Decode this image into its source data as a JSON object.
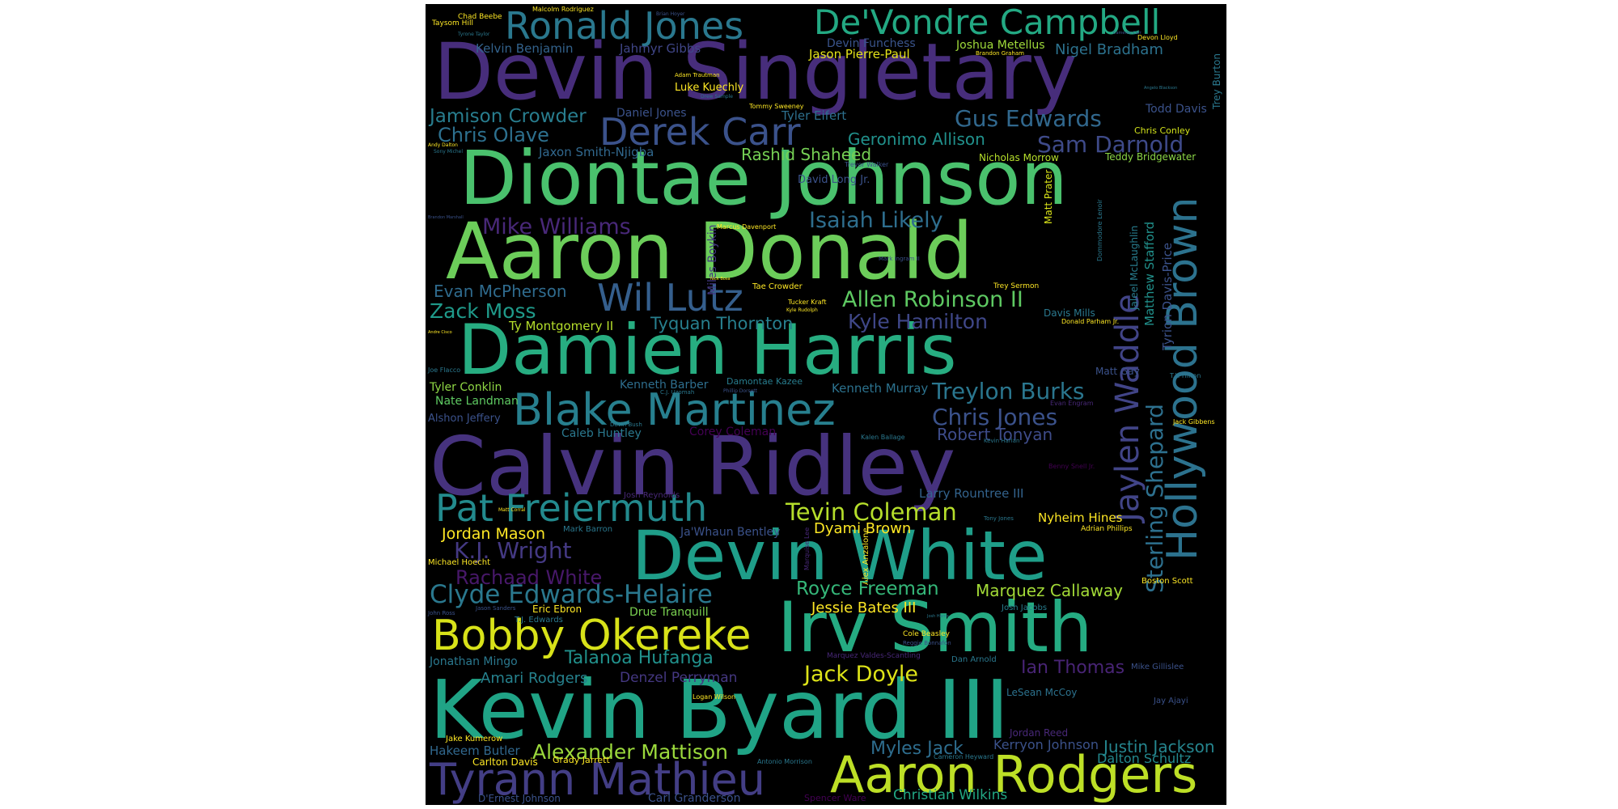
{
  "words": [
    {
      "text": "Devin Singletary",
      "color": "#472d7b"
    },
    {
      "text": "Diontae Johnson",
      "color": "#4ac16d"
    },
    {
      "text": "Aaron Donald",
      "color": "#6ccd5a"
    },
    {
      "text": "Damien Harris",
      "color": "#27ad81"
    },
    {
      "text": "Calvin Ridley",
      "color": "#46327e"
    },
    {
      "text": "Kevin Byard III",
      "color": "#20a486"
    },
    {
      "text": "Devin White",
      "color": "#1f9e89"
    },
    {
      "text": "Irv Smith",
      "color": "#25ab82"
    },
    {
      "text": "Ronald Jones",
      "color": "#2a788e"
    },
    {
      "text": "De'Vondre Campbell",
      "color": "#23a983"
    },
    {
      "text": "Hollywood Brown",
      "color": "#2c728e"
    },
    {
      "text": "Blake Martinez",
      "color": "#277f8e"
    },
    {
      "text": "Pat Freiermuth",
      "color": "#238a8d"
    },
    {
      "text": "Bobby Okereke",
      "color": "#d8e219"
    },
    {
      "text": "Aaron Rodgers",
      "color": "#bddf26"
    },
    {
      "text": "Tyrann Mathieu",
      "color": "#433e85"
    },
    {
      "text": "Derek Carr",
      "color": "#3b528b"
    },
    {
      "text": "Wil Lutz",
      "color": "#355f8d"
    },
    {
      "text": "Jaylen Waddle",
      "color": "#414487"
    },
    {
      "text": "Sterling Shepard",
      "color": "#2d708e"
    },
    {
      "text": "Gus Edwards",
      "color": "#31688e"
    },
    {
      "text": "Sam Darnold",
      "color": "#3e4a89"
    },
    {
      "text": "Mike Williams",
      "color": "#482878"
    },
    {
      "text": "Isaiah Likely",
      "color": "#2e6e8e"
    },
    {
      "text": "Allen Robinson II",
      "color": "#5ec962"
    },
    {
      "text": "Kyle Hamilton",
      "color": "#3f4788"
    },
    {
      "text": "Treylon Burks",
      "color": "#2a768e"
    },
    {
      "text": "Chris Jones",
      "color": "#3b528b"
    },
    {
      "text": "Robert Tonyan",
      "color": "#3e4c8a"
    },
    {
      "text": "Tevin Coleman",
      "color": "#b5de2b"
    },
    {
      "text": "Clyde Edwards-Helaire",
      "color": "#2a788e"
    },
    {
      "text": "K.J. Wright",
      "color": "#443983"
    },
    {
      "text": "Rachaad White",
      "color": "#48186a"
    },
    {
      "text": "Jordan Mason",
      "color": "#fde725"
    },
    {
      "text": "Alexander Mattison",
      "color": "#9bd93c"
    },
    {
      "text": "Jack Doyle",
      "color": "#dde318"
    },
    {
      "text": "Royce Freeman",
      "color": "#35b779"
    },
    {
      "text": "Marquez Callaway",
      "color": "#a2da37"
    },
    {
      "text": "Jessie Bates III",
      "color": "#fde725"
    },
    {
      "text": "Ian Thomas",
      "color": "#482475"
    },
    {
      "text": "Myles Jack",
      "color": "#2e6d8e"
    },
    {
      "text": "Justin Jackson",
      "color": "#25858e"
    },
    {
      "text": "Talanoa Hufanga",
      "color": "#21918c"
    },
    {
      "text": "Christian Wilkins",
      "color": "#22a884"
    },
    {
      "text": "Geronimo Allison",
      "color": "#21918c"
    },
    {
      "text": "Rashid Shaheed",
      "color": "#75d054"
    },
    {
      "text": "Jamison Crowder",
      "color": "#287d8e"
    },
    {
      "text": "Chris Olave",
      "color": "#2d708e"
    },
    {
      "text": "Nigel Bradham",
      "color": "#2c728e"
    },
    {
      "text": "Evan McPherson",
      "color": "#2f6b8e"
    },
    {
      "text": "Zack Moss",
      "color": "#1f9a8a"
    },
    {
      "text": "Tyquan Thornton",
      "color": "#277f8e"
    },
    {
      "text": "Dyami Brown",
      "color": "#fde725"
    },
    {
      "text": "Nyheim Hines",
      "color": "#fde725"
    },
    {
      "text": "Amari Rodgers",
      "color": "#26828e"
    },
    {
      "text": "Denzel Perryman",
      "color": "#453882"
    },
    {
      "text": "Kerryon Johnson",
      "color": "#3b528b"
    },
    {
      "text": "Dalton Schultz",
      "color": "#23898e"
    },
    {
      "text": "Hakeem Butler",
      "color": "#31688e"
    },
    {
      "text": "Kenneth Murray",
      "color": "#2c728e"
    },
    {
      "text": "Larry Rountree III",
      "color": "#33638d"
    },
    {
      "text": "Kelvin Benjamin",
      "color": "#33638d"
    },
    {
      "text": "Jahmyr Gibbs",
      "color": "#404688"
    },
    {
      "text": "Jason Pierre-Paul",
      "color": "#e5e419"
    },
    {
      "text": "Devin Funchess",
      "color": "#3a548c"
    },
    {
      "text": "Joshua Metellus",
      "color": "#9fda3a"
    },
    {
      "text": "Daniel Jones",
      "color": "#3b528b"
    },
    {
      "text": "Tyler Eifert",
      "color": "#2d708e"
    },
    {
      "text": "Jaxon Smith-Njigba",
      "color": "#31688e"
    },
    {
      "text": "Luke Kuechly",
      "color": "#fde725"
    },
    {
      "text": "Todd Davis",
      "color": "#3b528b"
    },
    {
      "text": "Teddy Bridgewater",
      "color": "#8bd646"
    },
    {
      "text": "Chris Conley",
      "color": "#d2e21b"
    },
    {
      "text": "Nicholas Morrow",
      "color": "#b5de2b"
    },
    {
      "text": "David Long Jr.",
      "color": "#3b528b"
    },
    {
      "text": "Kenneth Barber",
      "color": "#2e6e8e"
    },
    {
      "text": "Damontae Kazee",
      "color": "#287d8e"
    },
    {
      "text": "Caleb Huntley",
      "color": "#2a788e"
    },
    {
      "text": "Corey Coleman",
      "color": "#440154"
    },
    {
      "text": "Tyler Conklin",
      "color": "#8fd744"
    },
    {
      "text": "Nate Landman",
      "color": "#5ec962"
    },
    {
      "text": "Alshon Jeffery",
      "color": "#3b528b"
    },
    {
      "text": "Ty Montgomery II",
      "color": "#b5de2b"
    },
    {
      "text": "Ja'Whaun Bentley",
      "color": "#3b528b"
    },
    {
      "text": "Michael Hoecht",
      "color": "#fde725"
    },
    {
      "text": "Eric Ebron",
      "color": "#fde725"
    },
    {
      "text": "Drue Tranquill",
      "color": "#7ad151"
    },
    {
      "text": "Jonathan Mingo",
      "color": "#2a788e"
    },
    {
      "text": "Jake Kumerow",
      "color": "#fde725"
    },
    {
      "text": "Carlton Davis",
      "color": "#fde725"
    },
    {
      "text": "Grady Jarrett",
      "color": "#fde725"
    },
    {
      "text": "D'Ernest Johnson",
      "color": "#3b528b"
    },
    {
      "text": "Carl Granderson",
      "color": "#3b528b"
    },
    {
      "text": "Spencer Ware",
      "color": "#440154"
    },
    {
      "text": "Jordan Reed",
      "color": "#482878"
    },
    {
      "text": "LeSean McCoy",
      "color": "#2c728e"
    },
    {
      "text": "Matt Gay",
      "color": "#3b528b"
    },
    {
      "text": "Davis Mills",
      "color": "#2a788e"
    },
    {
      "text": "Boston Scott",
      "color": "#fde725"
    },
    {
      "text": "Matt Prater",
      "color": "#d8e219"
    },
    {
      "text": "Matthew Stafford",
      "color": "#21918c"
    },
    {
      "text": "Tyrion Davis-Price",
      "color": "#3b528b"
    },
    {
      "text": "Jaleel McLaughlin",
      "color": "#287d8e"
    },
    {
      "text": "Trey Burton",
      "color": "#2a788e"
    },
    {
      "text": "Miles Boykin",
      "color": "#443983"
    },
    {
      "text": "Alex Anzalone",
      "color": "#fde725"
    },
    {
      "text": "Malcolm Rodriguez",
      "color": "#fde725"
    },
    {
      "text": "Taysom Hill",
      "color": "#fde725"
    },
    {
      "text": "Tommy Sweeney",
      "color": "#fde725"
    },
    {
      "text": "Tucker Kraft",
      "color": "#fde725"
    },
    {
      "text": "Josh Reynolds",
      "color": "#482878"
    },
    {
      "text": "Cole Beasley",
      "color": "#fde725"
    },
    {
      "text": "Dan Arnold",
      "color": "#2a788e"
    },
    {
      "text": "Josh Jacobs",
      "color": "#287d8e"
    },
    {
      "text": "Adrian Phillips",
      "color": "#fde725"
    },
    {
      "text": "Mike Gillislee",
      "color": "#3b528b"
    },
    {
      "text": "Jay Ajayi",
      "color": "#3b528b"
    },
    {
      "text": "Jack Gibbens",
      "color": "#fde725"
    },
    {
      "text": "Joe Flacco",
      "color": "#2a788e"
    },
    {
      "text": "Antonio Morrison",
      "color": "#2a788e"
    },
    {
      "text": "Logan Wilson",
      "color": "#fde725"
    },
    {
      "text": "Marquez Valdes-Scantling",
      "color": "#482878"
    },
    {
      "text": "Cameron Heyward",
      "color": "#2a788e"
    },
    {
      "text": "Kalen Ballage",
      "color": "#2a788e"
    },
    {
      "text": "T.J. Edwards",
      "color": "#2a788e"
    },
    {
      "text": "Romeo Okwara",
      "color": "#fde725"
    },
    {
      "text": "Brandon McManus",
      "color": "#fde725"
    },
    {
      "text": "Marquise Lee",
      "color": "#482878"
    },
    {
      "text": "Kevin Harlan",
      "color": "#2a788e"
    },
    {
      "text": "Evan Engram",
      "color": "#482878"
    },
    {
      "text": "Kavier Woods",
      "color": "#2a788e"
    },
    {
      "text": "T.Y. Hilton",
      "color": "#2a788e"
    },
    {
      "text": "Donald Parham Jr.",
      "color": "#fde725"
    },
    {
      "text": "Trey Sermon",
      "color": "#fde725"
    },
    {
      "text": "Mark Ingram II",
      "color": "#3b528b"
    },
    {
      "text": "Marcus Davenport",
      "color": "#fde725"
    },
    {
      "text": "Trevor Walker",
      "color": "#3b528b"
    },
    {
      "text": "Dommodore Lenoir",
      "color": "#2a788e"
    },
    {
      "text": "Brandon Graham",
      "color": "#fde725"
    },
    {
      "text": "Devon Lloyd",
      "color": "#fde725"
    },
    {
      "text": "Adam Trautman",
      "color": "#fde725"
    },
    {
      "text": "Drew Sample",
      "color": "#2a788e"
    },
    {
      "text": "Andy Dalton",
      "color": "#fde725"
    },
    {
      "text": "Sony Michel",
      "color": "#2a788e"
    },
    {
      "text": "Matt Corral",
      "color": "#fde725"
    },
    {
      "text": "C.J. Uzomah",
      "color": "#2a788e"
    },
    {
      "text": "Devin Bush",
      "color": "#2a788e"
    },
    {
      "text": "Benny Snell Jr.",
      "color": "#440154"
    },
    {
      "text": "Tony Jones",
      "color": "#2a788e"
    },
    {
      "text": "Mark Barron",
      "color": "#2a788e"
    },
    {
      "text": "John Ross",
      "color": "#3b528b"
    },
    {
      "text": "Jason Sanders",
      "color": "#3b528b"
    },
    {
      "text": "Chad Beebe",
      "color": "#fde725"
    },
    {
      "text": "Brian Hoyer",
      "color": "#3b528b"
    },
    {
      "text": "Tyrone Taylor",
      "color": "#2a788e"
    },
    {
      "text": "Cameron Carr",
      "color": "#3b528b"
    },
    {
      "text": "Angelo Blackson",
      "color": "#2a788e"
    },
    {
      "text": "Brandon Marshall",
      "color": "#3b528b"
    },
    {
      "text": "Andre Cisco",
      "color": "#fde725"
    },
    {
      "text": "Tae Crowder",
      "color": "#fde725"
    },
    {
      "text": "Phillip Dorsett",
      "color": "#3b528b"
    },
    {
      "text": "Reggie Bonnafon",
      "color": "#3b528b"
    },
    {
      "text": "Nick Bosa",
      "color": "#fde725"
    },
    {
      "text": "Kyle Rudolph",
      "color": "#fde725"
    },
    {
      "text": "Josh Harris",
      "color": "#2a788e"
    }
  ]
}
